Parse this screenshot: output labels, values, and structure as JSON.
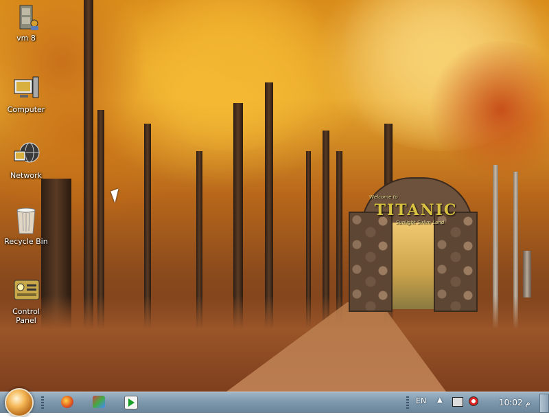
{
  "desktop": {
    "wallpaper": "autumn-forest-stone-arch",
    "arch_sign": {
      "main": "TITANIC",
      "small_top": "Welcome to",
      "sub": "Sunlight Sirlim Land"
    },
    "icons": [
      {
        "label": "vm 8",
        "icon": "cabinet-user-icon"
      },
      {
        "label": "Computer",
        "icon": "computer-icon"
      },
      {
        "label": "Network",
        "icon": "network-globe-icon"
      },
      {
        "label": "Recycle Bin",
        "icon": "recycle-bin-icon"
      },
      {
        "label": "Control Panel",
        "icon": "control-panel-icon"
      }
    ]
  },
  "taskbar": {
    "start_icon": "start-orb",
    "pinned": [
      {
        "icon": "firefox-icon"
      },
      {
        "icon": "media-icon"
      },
      {
        "icon": "media-player-icon"
      }
    ],
    "tray": {
      "language": "EN",
      "expand_arrow": "▲",
      "clock": "10:02 م"
    }
  },
  "colors": {
    "taskbar_top": "#9fb6c8",
    "taskbar_bottom": "#6a8499",
    "foliage": "#e5a42a"
  }
}
